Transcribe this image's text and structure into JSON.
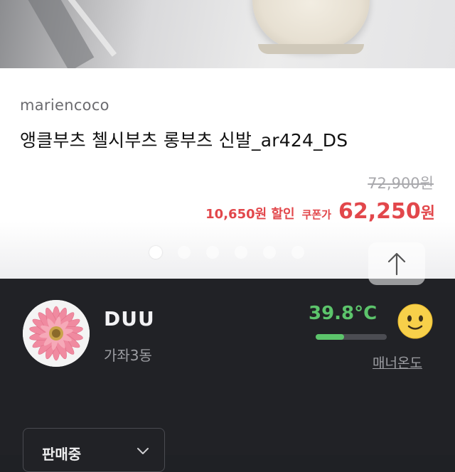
{
  "product": {
    "store": "mariencoco",
    "title": "앵클부츠 첼시부츠 롱부츠 신발_ar424_DS",
    "original_price": "72,900원",
    "discount": "10,650원 할인",
    "coupon_label": "쿠폰가",
    "final_price_value": "62,250",
    "final_price_unit": "원"
  },
  "carousel": {
    "total": 6,
    "active_index": 0
  },
  "seller": {
    "nickname": "DUU",
    "location": "가좌3동",
    "temperature": "39.8°C",
    "temperature_fill": 0.4,
    "manner_label": "매너온도",
    "temp_color": "#5cc46b"
  },
  "status_select": {
    "value": "판매중"
  },
  "colors": {
    "price_red": "#e2474b",
    "dark_bg": "#212226"
  },
  "icons": [
    "up-arrow-icon",
    "smiley-icon",
    "chevron-down-icon"
  ]
}
